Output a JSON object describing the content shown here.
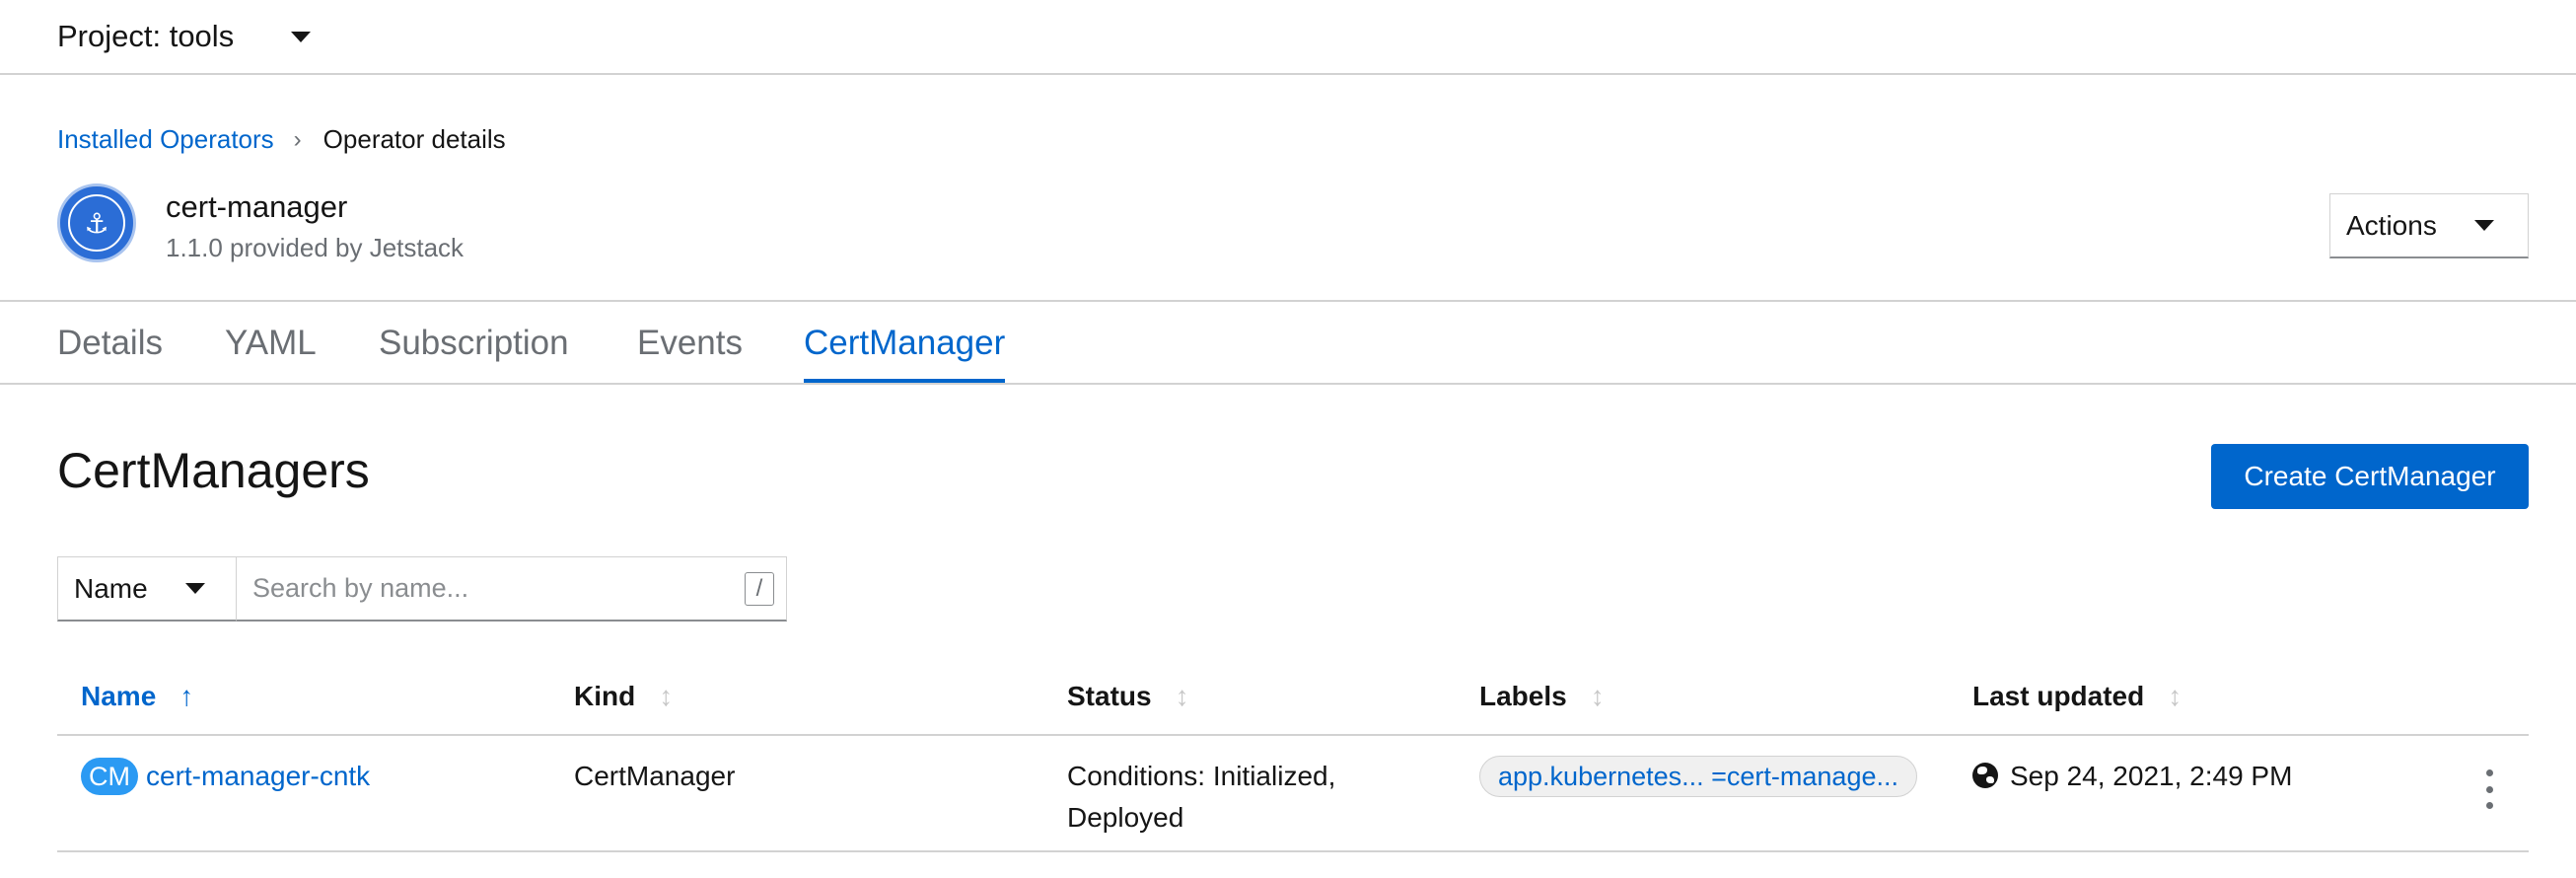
{
  "project_bar": {
    "label": "Project: tools"
  },
  "breadcrumb": {
    "parent": "Installed Operators",
    "separator": "›",
    "current": "Operator details"
  },
  "operator": {
    "name": "cert-manager",
    "version_provider": "1.1.0 provided by Jetstack",
    "logo_icon": "anchor-icon"
  },
  "actions": {
    "label": "Actions"
  },
  "tabs": [
    {
      "label": "Details"
    },
    {
      "label": "YAML"
    },
    {
      "label": "Subscription"
    },
    {
      "label": "Events"
    },
    {
      "label": "CertManager",
      "active": true
    }
  ],
  "section": {
    "title": "CertManagers",
    "create_label": "Create CertManager"
  },
  "filter": {
    "selected": "Name",
    "placeholder": "Search by name...",
    "shortcut": "/"
  },
  "table": {
    "columns": [
      {
        "label": "Name",
        "sorted": "ascending"
      },
      {
        "label": "Kind"
      },
      {
        "label": "Status"
      },
      {
        "label": "Labels"
      },
      {
        "label": "Last updated"
      }
    ],
    "rows": [
      {
        "badge": "CM",
        "name": "cert-manager-cntk",
        "kind": "CertManager",
        "status_line1": "Conditions: Initialized,",
        "status_line2": "Deployed",
        "label": "app.kubernetes... =cert-manage...",
        "last_updated": "Sep 24, 2021, 2:49 PM"
      }
    ]
  },
  "colors": {
    "accent": "#0066cc",
    "badge": "#2b9af3",
    "border": "#d2d2d2",
    "muted": "#6a6e73"
  }
}
